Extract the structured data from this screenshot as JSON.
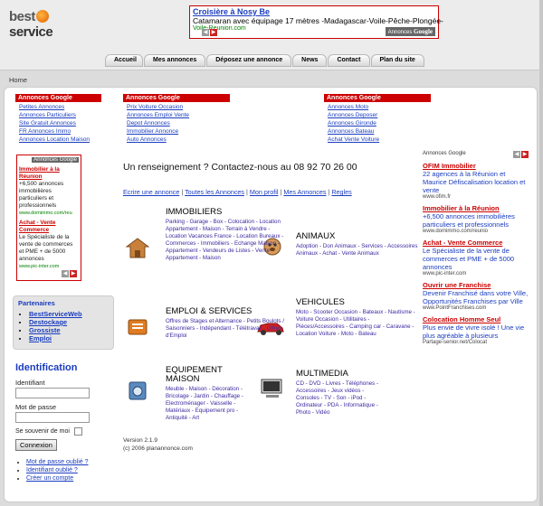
{
  "logo": {
    "text_a": "best",
    "text_b": "service"
  },
  "top_ad": {
    "title": "Croisière à Nosy Be",
    "desc": "Catamaran avec équipage 17 mètres -Madagascar-Voile-Pêche-Plongée-",
    "url": "Voile-Reunion.com",
    "badge_a": "Annonces",
    "badge_b": "Google"
  },
  "nav": [
    "Accueil",
    "Mes annonces",
    "Déposez une annonce",
    "News",
    "Contact",
    "Plan du site"
  ],
  "breadcrumb": "Home",
  "ad_columns": [
    {
      "head": "Annonces Google",
      "items": [
        "Petites Annonces",
        "Annonces Particuliers",
        "Site Gratuit Annonces",
        "FR Annonces Immo",
        "Annonces Location Maison"
      ]
    },
    {
      "head": "Annonces Google",
      "items": [
        "Prix Voiture Occasion",
        "Annonces Emploi Vente",
        "Depot Annonces",
        "Immobilier Annonce",
        "Auto Annonces"
      ]
    },
    {
      "head": "Annonces Google",
      "items": [
        "Annonces Moto",
        "Annonces Deposer",
        "Annonces Gironde",
        "Annonces Bateau",
        "Achat Vente Voiture"
      ]
    }
  ],
  "left_ad": {
    "badge": "Annonces Google",
    "ads": [
      {
        "title": "Immobilier à la Réunion",
        "desc": "+6,500 annonces immobilières particuliers et professionnels",
        "url": "www.domimmo.com/reu"
      },
      {
        "title": "Achat - Vente Commerce",
        "desc": "Le Spécialiste de la vente de commerces et PME + de 5000 annonces",
        "url": "www.pic-inter.com"
      }
    ]
  },
  "partners": {
    "title": "Partenaires",
    "items": [
      "BestServiceWeb",
      "Destockage",
      "Grossiste",
      "Emploi"
    ]
  },
  "login": {
    "title": "Identification",
    "user_label": "Identifiant",
    "pass_label": "Mot de passe",
    "remember": "Se souvenir de moi",
    "button": "Connexion",
    "links": [
      "Mot de passe oublié ?",
      "Identifiant oublié ?",
      "Créer un compte"
    ]
  },
  "contact": "Un renseignement ? Contactez-nous au 08 92 70 26 00",
  "links": [
    "Ecrire une annonce",
    "Toutes les Annonces",
    "Mon profil",
    "Mes Annonces",
    "Regles"
  ],
  "categories": [
    {
      "title": "IMMOBILIERS",
      "sub": "Parking - Garage - Box - Colocation - Location Appartement - Maison - Terrain à Vendre - Location Vacances France - Location Bureaux - Commerces - Immobiliers - Echange Maison - Appartement - Vendeurs de Listes - Vente Appartement - Maison"
    },
    {
      "title": "ANIMAUX",
      "sub": "Adoption - Don Animaux - Services - Accessoires Animaux - Achat - Vente Animaux"
    },
    {
      "title": "EMPLOI & SERVICES",
      "sub": "Offres de Stages et Alternance - Petits Boulots / Saisonniers - Indépendant - Télétravail - Offres d'Emploi"
    },
    {
      "title": "VEHICULES",
      "sub": "Moto - Scooter Occasion - Bateaux - Nautisme - Voiture Occasion - Utilitaires - Pièces/Accessoires - Camping car - Caravane - Location Voiture - Moto - Bateau"
    },
    {
      "title": "EQUIPEMENT MAISON",
      "sub": "Meuble - Maison - Décoration - Bricolage - Jardin - Chauffage - Electroménager - Vaisselle - Matériaux - Equipement pro - Antiquité - Art"
    },
    {
      "title": "MULTIMEDIA",
      "sub": "CD - DVD - Livres - Téléphones - Accessoires - Jeux vidéos - Consoles - TV - Son - iPod - Ordinateur - PDA - Informatique - Photo - Vidéo"
    }
  ],
  "version": {
    "line1": "Version 2.1.9",
    "line2": "(c) 2006 planannonce.com"
  },
  "right_ads": {
    "badge": "Annonces Google",
    "ads": [
      {
        "title": "OFIM Immobilier",
        "desc": "22 agences à la Réunion et Maurice Défiscalisation location et vente",
        "url": "www.ofim.fr"
      },
      {
        "title": "Immobilier à la Réunion",
        "desc": "+6,500 annonces immobilières particuliers et professionnels",
        "url": "www.domimmo.com/reunio"
      },
      {
        "title": "Achat - Vente Commerce",
        "desc": "Le Spécialiste de la vente de commerces et PME + de 5000 annonces",
        "url": "www.pic-inter.com"
      },
      {
        "title": "Ouvrir une Franchise",
        "desc": "Devenir Franchisé dans votre Ville, Opportunités Franchises par Ville",
        "url": "www.PointFranchises.com"
      },
      {
        "title": "Colocation Homme Seul",
        "desc": "Plus envie de vivre isolé ! Une vie plus agréable à plusieurs",
        "url": "Partage-senior.net/Colocat"
      }
    ]
  }
}
